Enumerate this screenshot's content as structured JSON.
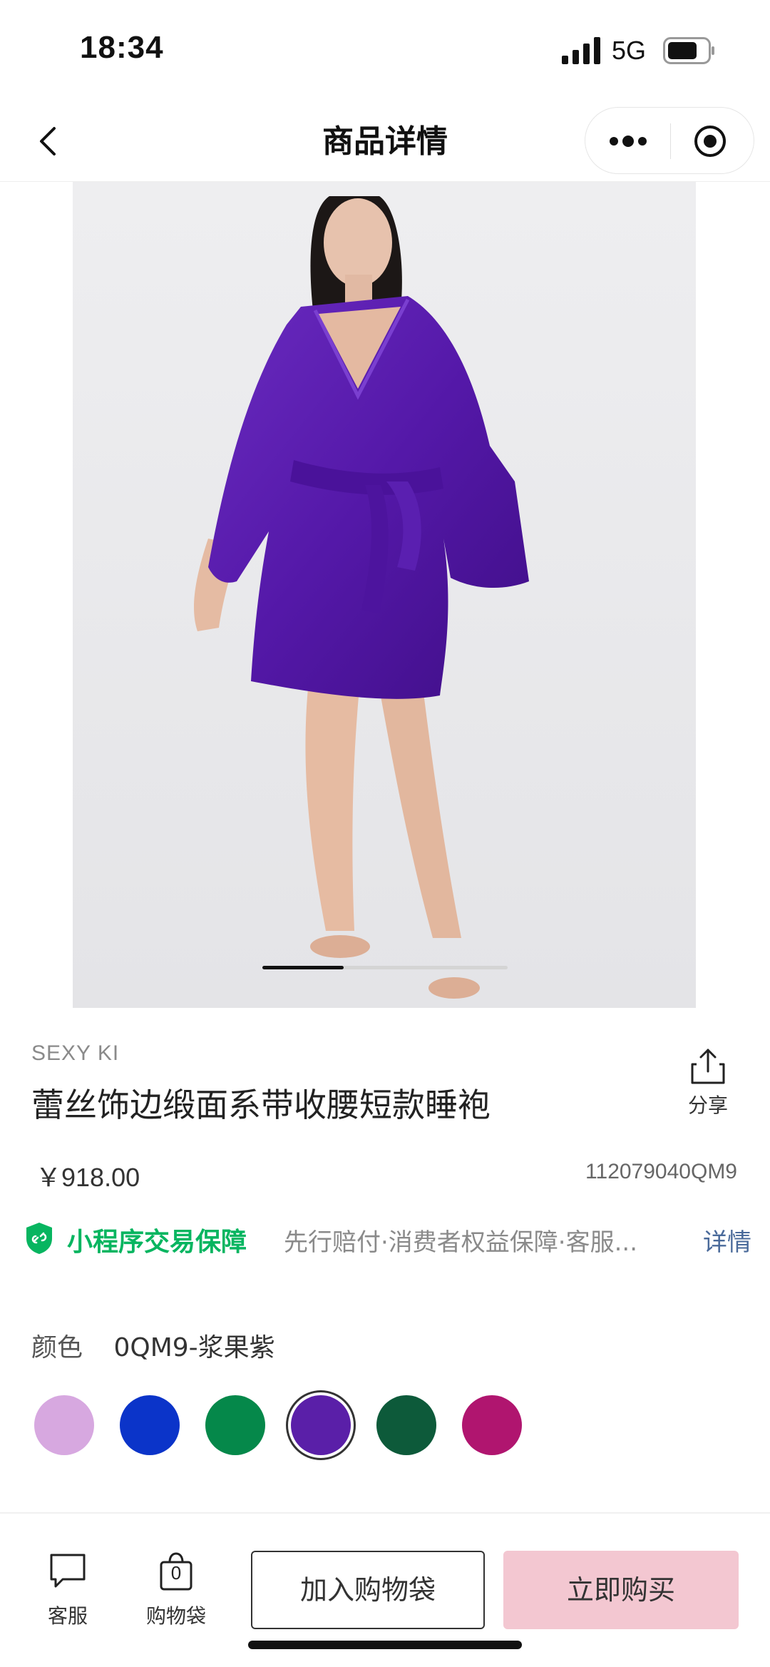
{
  "status_bar": {
    "time": "18:34",
    "network": "5G"
  },
  "nav": {
    "title": "商品详情"
  },
  "product": {
    "brand": "SEXY KI",
    "title": "蕾丝饰边缎面系带收腰短款睡袍",
    "price": "￥918.00",
    "sku": "112079040QM9",
    "image_alt": "purple-satin-robe-photo",
    "carousel_progress": 0.33
  },
  "share": {
    "label": "分享"
  },
  "guarantee": {
    "label": "小程序交易保障",
    "description": "先行赔付·消费者权益保障·客服...",
    "detail_link": "详情",
    "color": "#07b560"
  },
  "color_select": {
    "label": "颜色",
    "value": "0QM9-浆果紫",
    "swatches": [
      {
        "color": "#d7a8e0",
        "selected": false
      },
      {
        "color": "#0b34c9",
        "selected": false
      },
      {
        "color": "#05884a",
        "selected": false
      },
      {
        "color": "#5a1fa8",
        "selected": true
      },
      {
        "color": "#0d5a3a",
        "selected": false
      },
      {
        "color": "#b0156f",
        "selected": false
      }
    ]
  },
  "bottom_bar": {
    "service_label": "客服",
    "bag_label": "购物袋",
    "bag_count": "0",
    "add_to_bag": "加入购物袋",
    "buy_now": "立即购买",
    "buy_now_color": "#f3c7d1"
  }
}
